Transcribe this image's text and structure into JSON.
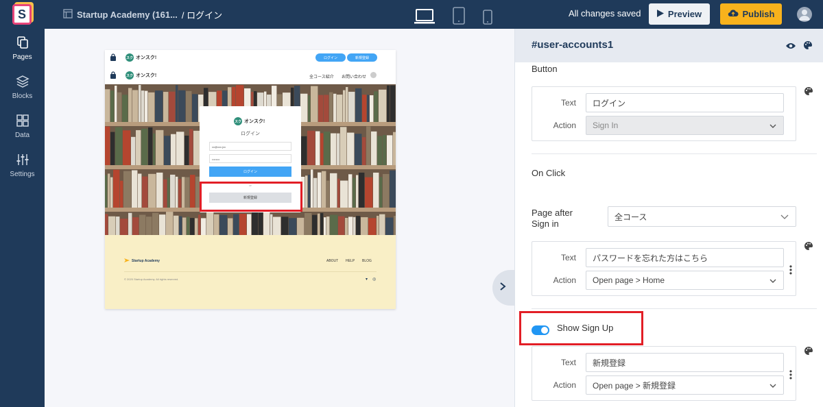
{
  "topbar": {
    "project_name": "Startup Academy (161...",
    "page_name": "/ ログイン",
    "saved_status": "All changes saved",
    "preview_label": "Preview",
    "publish_label": "Publish"
  },
  "sidebar": {
    "items": [
      {
        "label": "Pages",
        "icon": "pages-icon"
      },
      {
        "label": "Blocks",
        "icon": "blocks-icon"
      },
      {
        "label": "Data",
        "icon": "data-icon"
      },
      {
        "label": "Settings",
        "icon": "settings-icon"
      }
    ]
  },
  "preview": {
    "brand": "オンスク!",
    "header_login": "ログイン",
    "header_signup": "新規登録",
    "nav_courses": "全コース紹介",
    "nav_contact": "お問い合わせ",
    "card_brand": "オンスク!",
    "card_title": "ログイン",
    "email_value": "xx@xxx.jxx",
    "password_value": "••••••••",
    "login_button": "ログイン",
    "or_text": "or",
    "signup_button": "新規登録",
    "footer_brand": "Startup Academy",
    "footer_about": "ABOUT",
    "footer_help": "HELP",
    "footer_blog": "BLOG",
    "footer_copyright": "© 2020 Startup Academy. All rights reserved."
  },
  "panel": {
    "title": "#user-accounts1",
    "button_section": "Button",
    "button_text_label": "Text",
    "button_text_value": "ログイン",
    "button_action_label": "Action",
    "button_action_value": "Sign In",
    "on_click_label": "On Click",
    "page_after_label_1": "Page after",
    "page_after_label_2": "Sign in",
    "page_after_value": "全コース",
    "forgot_text_label": "Text",
    "forgot_text_value": "パスワードを忘れた方はこちら",
    "forgot_action_label": "Action",
    "forgot_action_value": "Open page > Home",
    "show_signup_label": "Show Sign Up",
    "signup_text_label": "Text",
    "signup_text_value": "新規登録",
    "signup_action_label": "Action",
    "signup_action_value": "Open page > 新規登録"
  },
  "colors": {
    "topbar": "#1f3a5a",
    "publish": "#f8b21c",
    "highlight": "#e21e26",
    "toggle": "#2196f3",
    "footer": "#f9efc6"
  }
}
